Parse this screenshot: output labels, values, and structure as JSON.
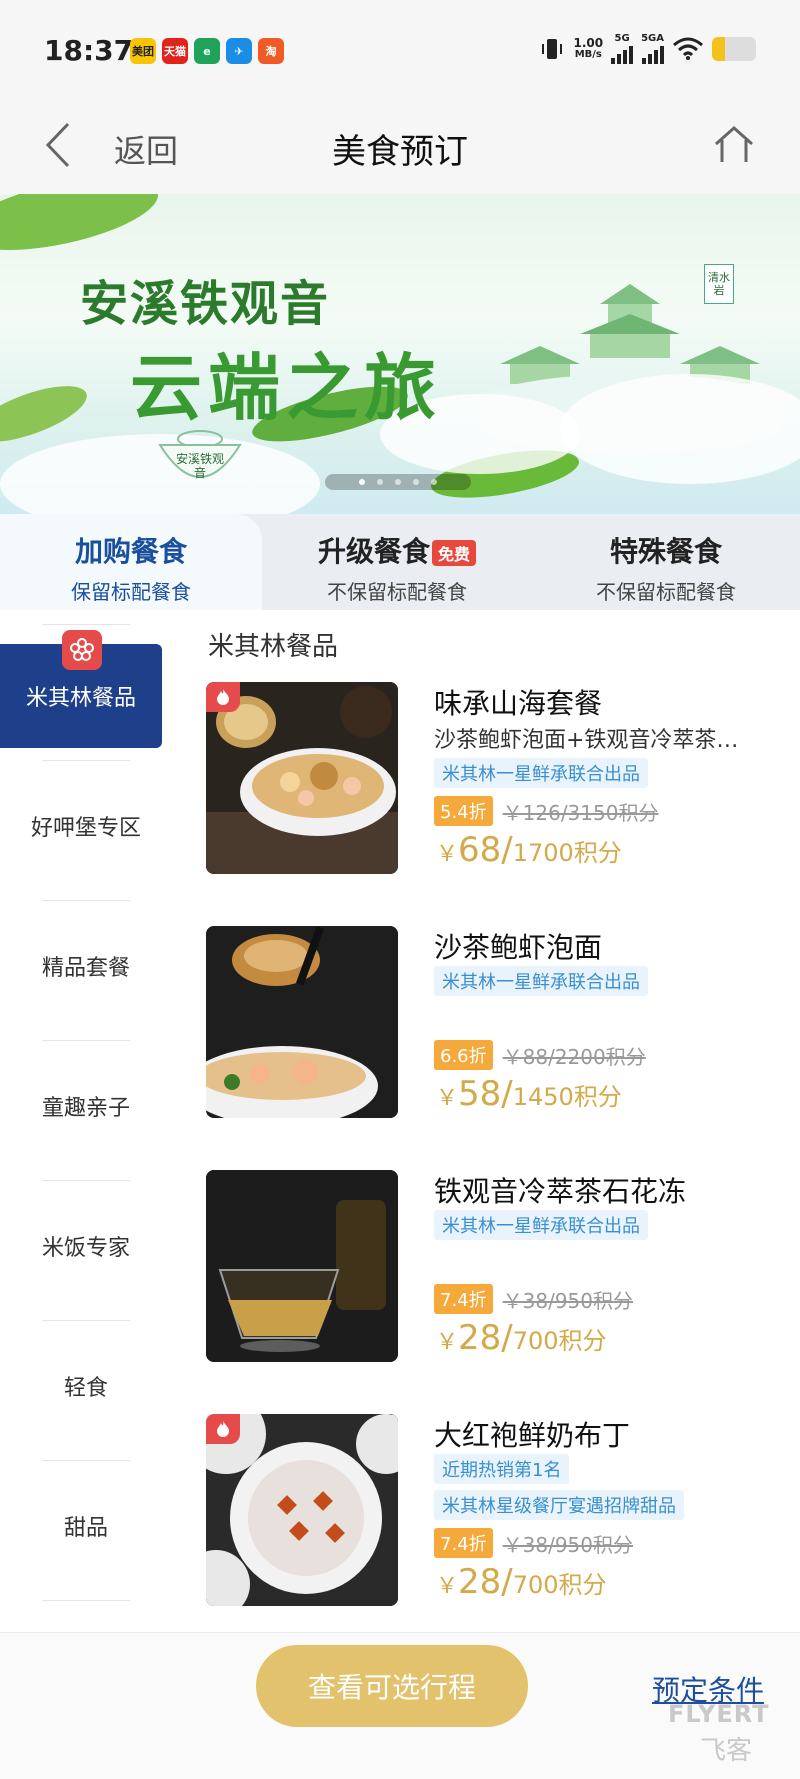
{
  "status_bar": {
    "time": "18:37",
    "apps": [
      {
        "label": "美团",
        "color": "#f7c600"
      },
      {
        "label": "天猫",
        "color": "#e0241b"
      },
      {
        "label": "e",
        "color": "#1fa35a"
      },
      {
        "label": "✈",
        "color": "#1a8ee6"
      },
      {
        "label": "淘",
        "color": "#f15a24"
      }
    ],
    "net_speed": "1.00",
    "net_unit": "MB/s",
    "sig1": "5G",
    "sig2": "5GA",
    "battery_level": 0.3
  },
  "nav": {
    "back_label": "返回",
    "title": "美食预订"
  },
  "banner": {
    "line1": "安溪铁观音",
    "line2": "云端之旅",
    "seal": "清水岩",
    "teapot_label": "安溪铁观音"
  },
  "tabs": [
    {
      "label": "加购餐食",
      "sub": "保留标配餐食",
      "badge": ""
    },
    {
      "label": "升级餐食",
      "sub": "不保留标配餐食",
      "badge": "免费"
    },
    {
      "label": "特殊餐食",
      "sub": "不保留标配餐食",
      "badge": ""
    }
  ],
  "sidebar": [
    {
      "label": "米其林餐品"
    },
    {
      "label": "好呷堡专区"
    },
    {
      "label": "精品套餐"
    },
    {
      "label": "童趣亲子"
    },
    {
      "label": "米饭专家"
    },
    {
      "label": "轻食"
    },
    {
      "label": "甜品"
    }
  ],
  "section_title": "米其林餐品",
  "products": [
    {
      "name": "味承山海套餐",
      "desc": "沙茶鲍虾泡面+铁观音冷萃茶…",
      "tags": [
        "米其林一星鲜承联合出品"
      ],
      "discount": "5.4折",
      "original": "￥126/3150积分",
      "currency": "￥",
      "price": "68/",
      "points": "1700积分"
    },
    {
      "name": "沙茶鲍虾泡面",
      "desc": "",
      "tags": [
        "米其林一星鲜承联合出品"
      ],
      "discount": "6.6折",
      "original": "￥88/2200积分",
      "currency": "￥",
      "price": "58/",
      "points": "1450积分"
    },
    {
      "name": "铁观音冷萃茶石花冻",
      "desc": "",
      "tags": [
        "米其林一星鲜承联合出品"
      ],
      "discount": "7.4折",
      "original": "￥38/950积分",
      "currency": "￥",
      "price": "28/",
      "points": "700积分"
    },
    {
      "name": "大红袍鲜奶布丁",
      "desc": "",
      "tags": [
        "近期热销第1名",
        "米其林星级餐厅宴遇招牌甜品"
      ],
      "discount": "7.4折",
      "original": "￥38/950积分",
      "currency": "￥",
      "price": "28/",
      "points": "700积分"
    }
  ],
  "bottom": {
    "trip_button": "查看可选行程",
    "conditions_link": "预定条件"
  },
  "watermark": {
    "line1": "FLYERT",
    "line2": "飞客"
  },
  "colors": {
    "accent_blue": "#1e3f8a",
    "gold": "#d4a94a",
    "discount_orange": "#f4a93a",
    "tag_blue": "#3b8fd0",
    "hot_red": "#e64b4b"
  }
}
